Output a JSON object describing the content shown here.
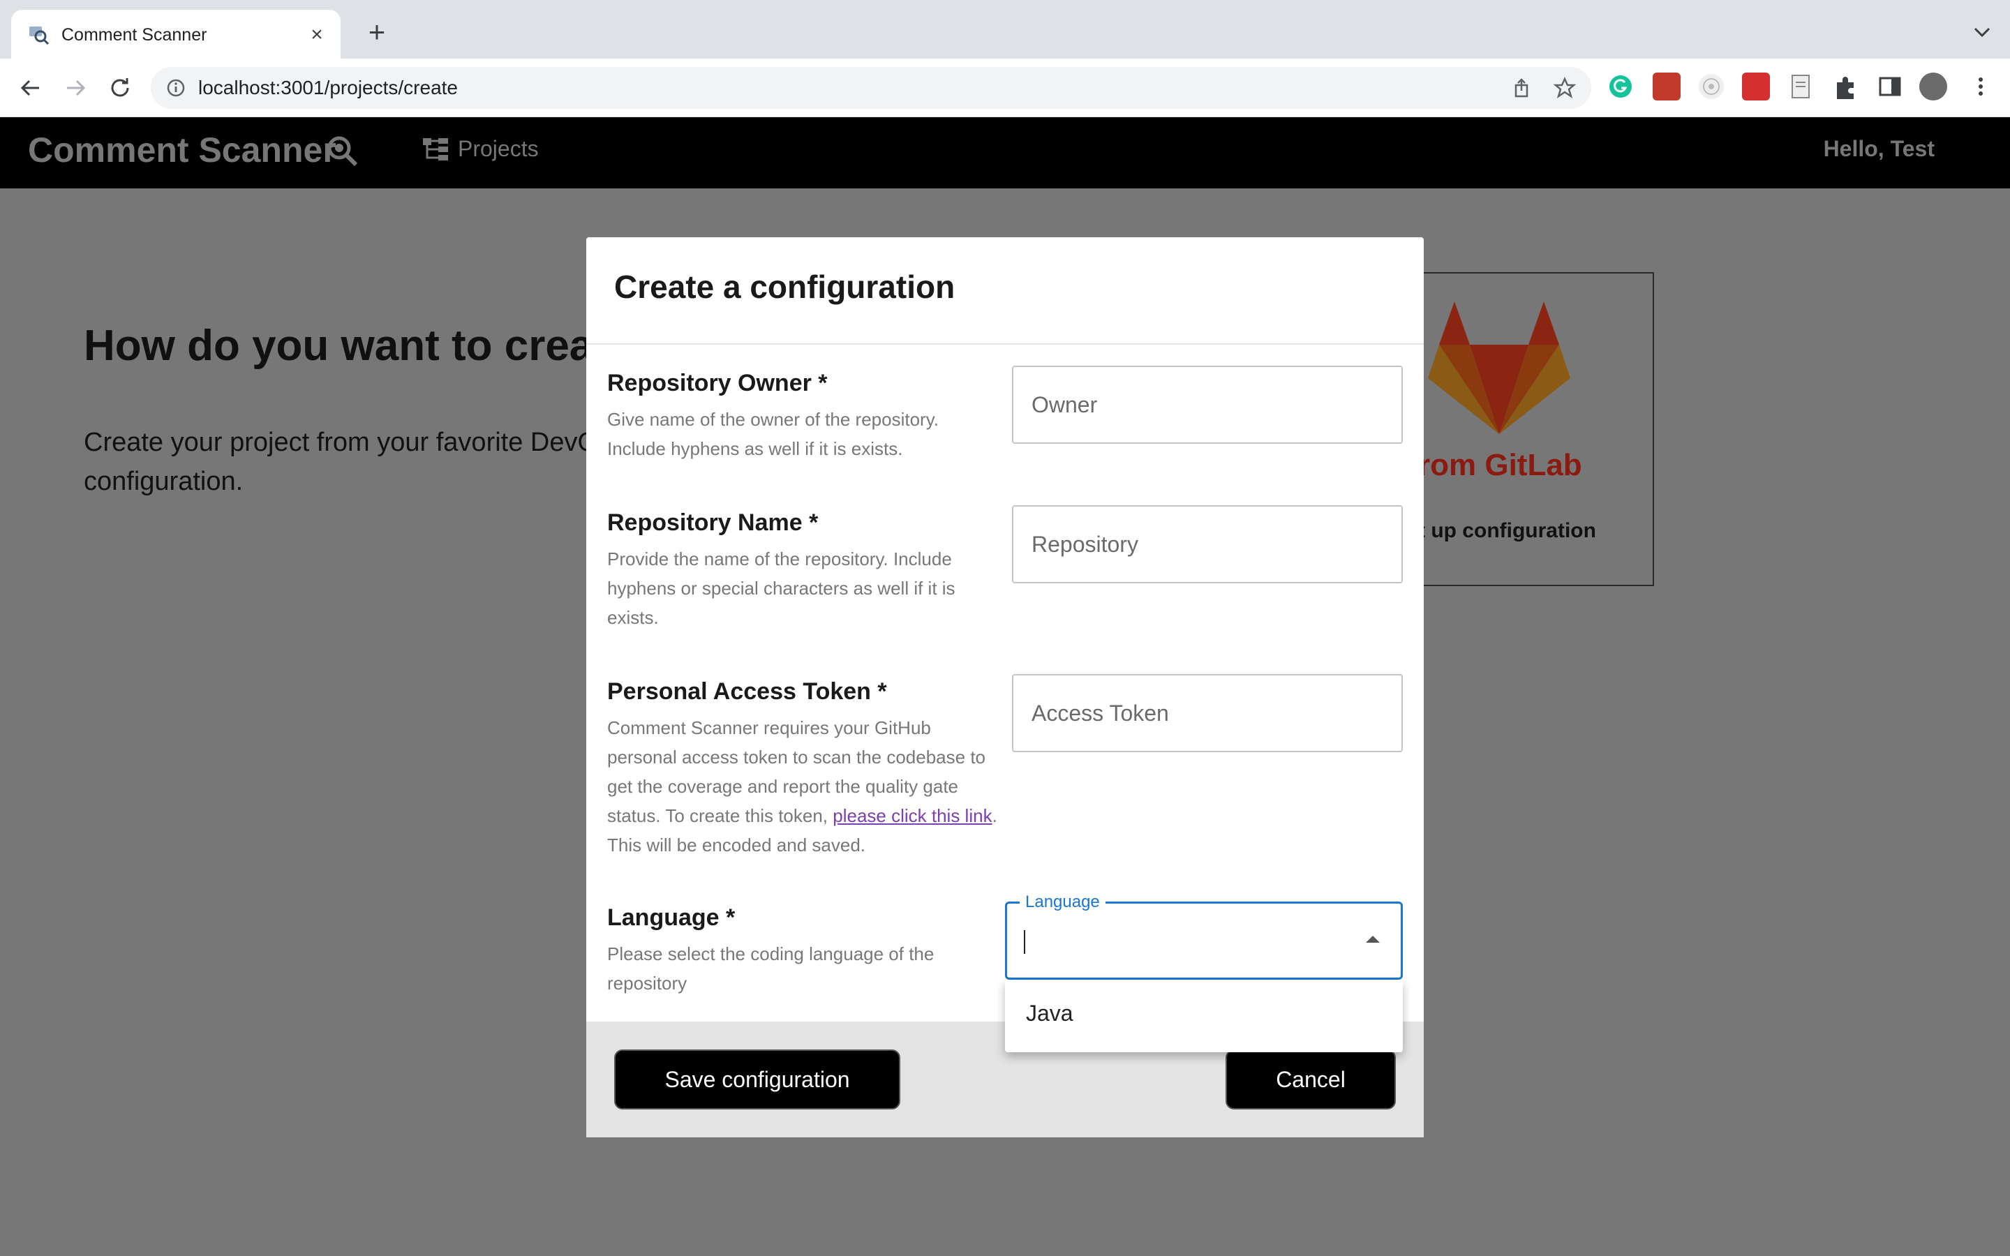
{
  "browser": {
    "tab_title": "Comment Scanner",
    "tab_close": "×",
    "new_tab": "+",
    "url": "localhost:3001/projects/create"
  },
  "app": {
    "brand": "Comment Scanner",
    "nav_projects": "Projects",
    "greeting": "Hello, Test"
  },
  "page": {
    "heading": "How do you want to crea",
    "description": "Create your project from your favorite DevO configuration.",
    "gitlab_card": {
      "title": "rom GitLab",
      "subtitle": "t up configuration"
    }
  },
  "modal": {
    "title": "Create a configuration",
    "owner": {
      "label": "Repository Owner *",
      "help": "Give name of the owner of the repository. Include hyphens as well if it is exists.",
      "placeholder": "Owner"
    },
    "repo": {
      "label": "Repository Name *",
      "help": "Provide the name of the repository. Include hyphens or special characters as well if it is exists.",
      "placeholder": "Repository"
    },
    "token": {
      "label": "Personal Access Token *",
      "help_before": "Comment Scanner requires your GitHub personal access token to scan the codebase to get the coverage and report the quality gate status. To create this token, ",
      "help_link": "please click this link",
      "help_after": ". This will be encoded and saved.",
      "placeholder": "Access Token"
    },
    "language": {
      "label": "Language *",
      "help": "Please select the coding language of the repository",
      "field_legend": "Language",
      "value": "",
      "options": [
        "Java"
      ]
    },
    "save_label": "Save configuration",
    "cancel_label": "Cancel"
  },
  "colors": {
    "accent": "#1976d2",
    "header_bg": "#000000",
    "overlay": "#777777",
    "link": "#7b3fae",
    "gitlab_red": "#e24329",
    "gitlab_orange": "#fc6d26",
    "gitlab_yellow": "#fca326"
  },
  "icons": {
    "favicon": "magnifier-icon",
    "brand_icon": "magnifier-bug-icon",
    "projects_icon": "tree-structure-icon",
    "gitlab_logo": "gitlab-fox-logo"
  }
}
